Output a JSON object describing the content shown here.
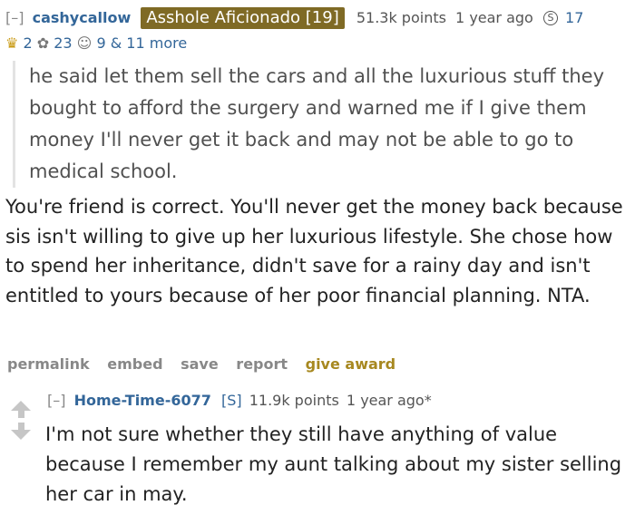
{
  "comment1": {
    "toggle": "[–]",
    "author": "cashycallow",
    "flair": "Asshole Aficionado [19]",
    "points": "51.3k points",
    "time": "1 year ago",
    "silver_count": "17",
    "awards": {
      "gold_count": "2",
      "helpful_count": "23",
      "wholesome_count": "9",
      "more_text": "& 11 more"
    },
    "quote": "he said let them sell the cars and all the luxurious stuff they bought to afford the surgery and warned me if I give them money I'll never get it back and may not be able to go to medical school.",
    "body": "You're friend is correct. You'll never get the money back because sis isn't willing to give up her luxurious lifestyle. She chose how to spend her inheritance, didn't save for a rainy day and isn't entitled to yours because of her poor financial planning. NTA.",
    "actions": {
      "permalink": "permalink",
      "embed": "embed",
      "save": "save",
      "report": "report",
      "give_award": "give award"
    }
  },
  "comment2": {
    "toggle": "[–]",
    "author": "Home-Time-6077",
    "op_tag": "[S]",
    "points": "11.9k points",
    "time": "1 year ago*",
    "body": "I'm not sure whether they still have anything of value because I remember my aunt talking about my sister selling her car in may."
  },
  "colors": {
    "author_link": "#336699",
    "flair_bg": "#7f6a25",
    "give_award": "#a78820",
    "vote_arrow": "#c6c6c6"
  },
  "icons": [
    "silver-award-icon",
    "gold-award-icon",
    "helpful-award-icon",
    "wholesome-award-icon",
    "upvote-arrow-icon",
    "downvote-arrow-icon"
  ]
}
